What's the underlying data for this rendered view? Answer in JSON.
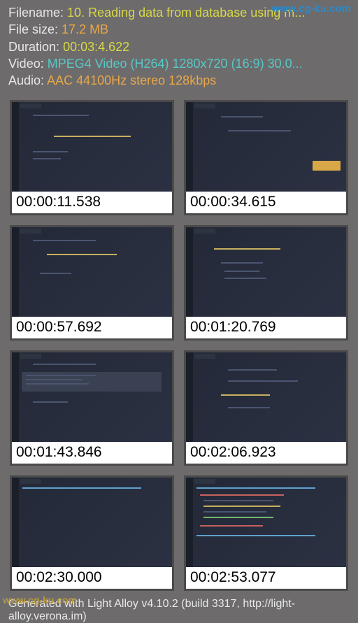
{
  "watermarks": {
    "top": "www.cg-ku.com",
    "bottom": "www.cg-ku.com"
  },
  "info": {
    "filename_label": "Filename:",
    "filename_value": "10. Reading data from database using m...",
    "filesize_label": "File size:",
    "filesize_value": "17.2 MB",
    "duration_label": "Duration:",
    "duration_value": "00:03:4.622",
    "video_label": "Video:",
    "video_value": "MPEG4 Video (H264) 1280x720 (16:9) 30.0...",
    "audio_label": "Audio:",
    "audio_value": "AAC 44100Hz stereo 128kbps"
  },
  "thumbnails": [
    {
      "time": "00:00:11.538"
    },
    {
      "time": "00:00:34.615"
    },
    {
      "time": "00:00:57.692"
    },
    {
      "time": "00:01:20.769"
    },
    {
      "time": "00:01:43.846"
    },
    {
      "time": "00:02:06.923"
    },
    {
      "time": "00:02:30.000"
    },
    {
      "time": "00:02:53.077"
    }
  ],
  "footer": "Generated with Light Alloy v4.10.2 (build 3317, http://light-alloy.verona.im)"
}
